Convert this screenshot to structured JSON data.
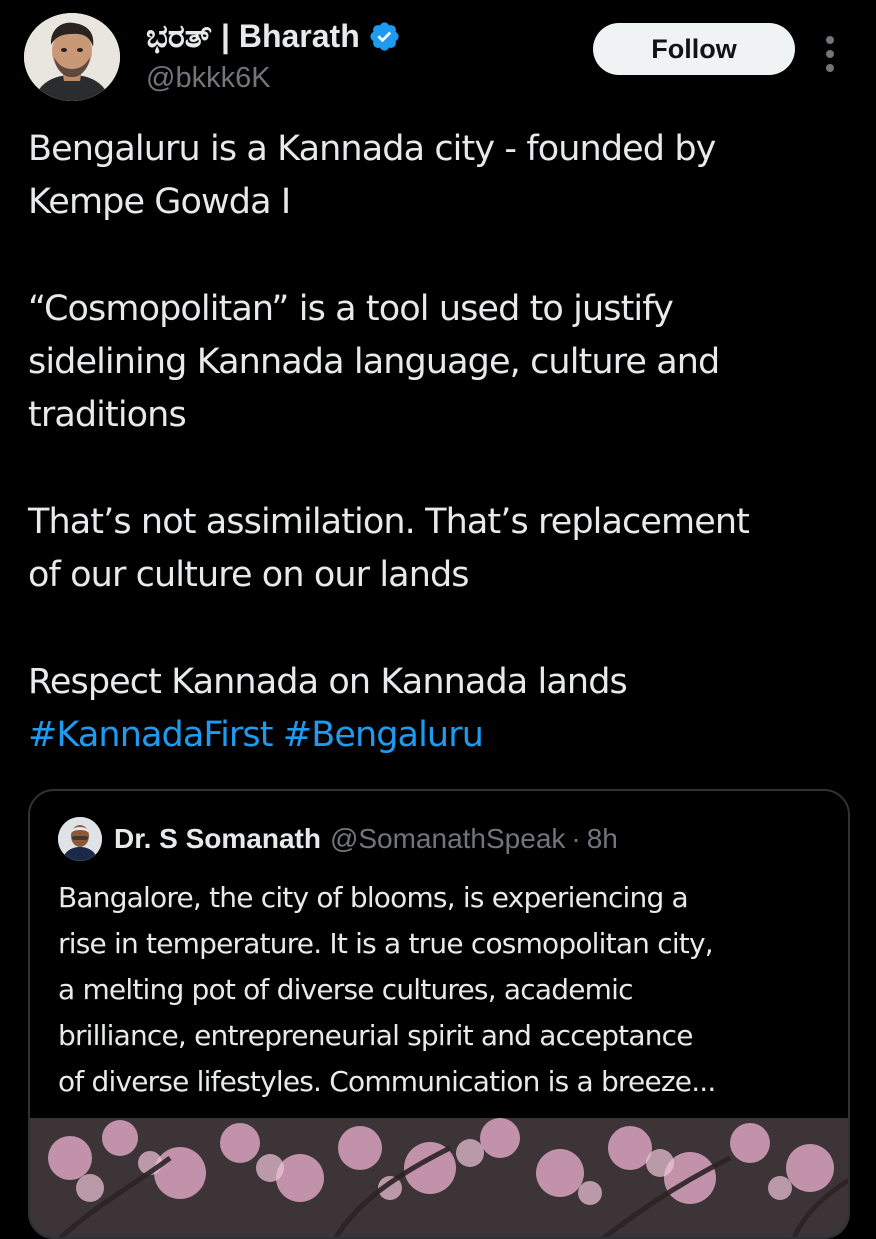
{
  "author": {
    "display_name": "ಭರತ್ | Bharath",
    "handle": "@bkkk6K",
    "verified": true
  },
  "actions": {
    "follow_label": "Follow"
  },
  "tweet": {
    "lines_1": [
      "Bengaluru is a Kannada city - founded by",
      "Kempe Gowda I"
    ],
    "para_2": [
      "“Cosmopolitan” is a tool used to justify",
      "sidelining Kannada language, culture and",
      "traditions"
    ],
    "para_3": [
      "That’s not assimilation. That’s replacement",
      "of our culture on our lands"
    ],
    "para_4": "Respect Kannada on Kannada lands",
    "hashtags": [
      "#KannadaFirst",
      "#Bengaluru"
    ]
  },
  "quoted_tweet": {
    "name": "Dr. S Somanath",
    "handle": "@SomanathSpeak",
    "separator": "·",
    "time": "8h",
    "lines": [
      "Bangalore, the city of blooms, is experiencing a",
      "rise in temperature. It is a true cosmopolitan city,",
      "a melting pot of diverse cultures, academic",
      "brilliance, entrepreneurial spirit and acceptance",
      "of diverse lifestyles. Communication is a breeze..."
    ]
  },
  "colors": {
    "background": "#000000",
    "text": "#e7e9ea",
    "muted": "#71767b",
    "link": "#1d9bf0",
    "verified": "#1d9bf0",
    "border": "#2f3336"
  },
  "icons": {
    "verified": "verified-badge-icon",
    "more": "more-vertical-icon"
  }
}
